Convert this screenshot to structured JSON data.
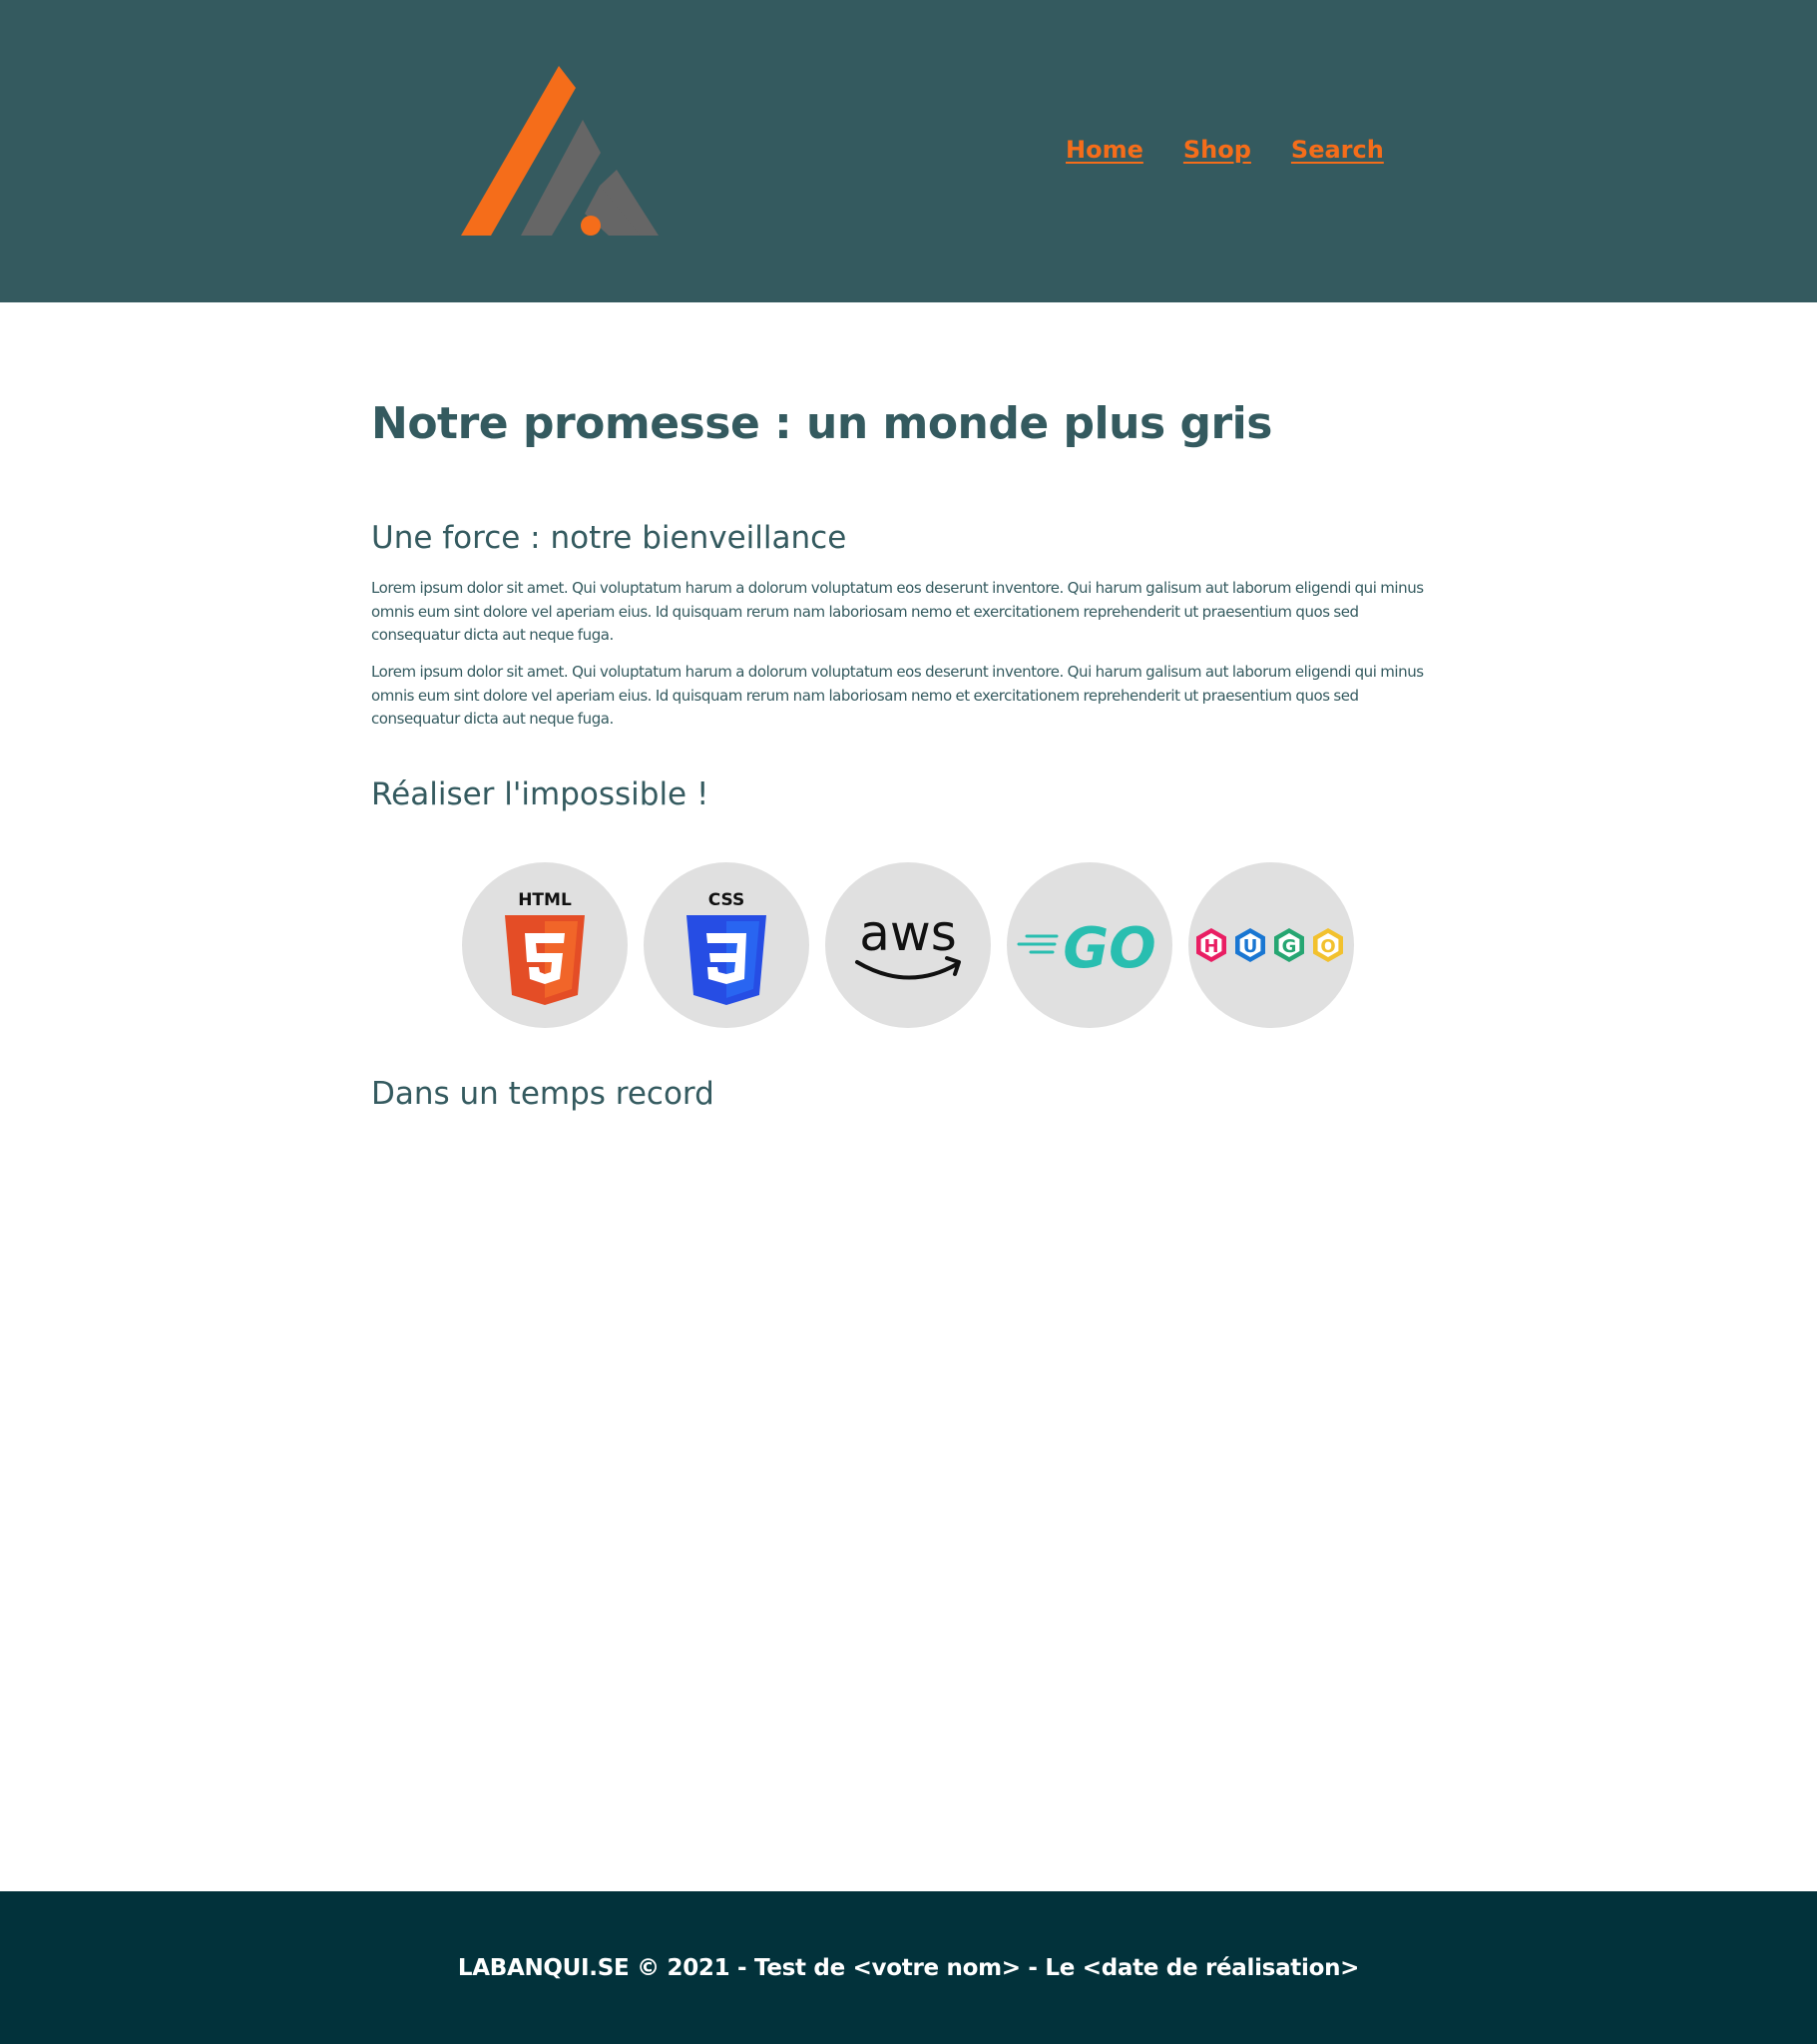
{
  "header": {
    "logo_name": "labanquise-logo",
    "nav": [
      {
        "label": "Home"
      },
      {
        "label": "Shop"
      },
      {
        "label": "Search"
      }
    ]
  },
  "main": {
    "title": "Notre promesse : un monde plus gris",
    "sections": [
      {
        "heading": "Une force : notre bienveillance",
        "paragraphs": [
          "Lorem ipsum dolor sit amet. Qui voluptatum harum a dolorum voluptatum eos deserunt inventore. Qui harum galisum aut laborum eligendi qui minus omnis eum sint dolore vel aperiam eius. Id quisquam rerum nam laboriosam nemo et exercitationem reprehenderit ut praesentium quos sed consequatur dicta aut neque fuga.",
          "Lorem ipsum dolor sit amet. Qui voluptatum harum a dolorum voluptatum eos deserunt inventore. Qui harum galisum aut laborum eligendi qui minus omnis eum sint dolore vel aperiam eius. Id quisquam rerum nam laboriosam nemo et exercitationem reprehenderit ut praesentium quos sed consequatur dicta aut neque fuga."
        ]
      },
      {
        "heading": "Réaliser l'impossible !",
        "technologies": [
          {
            "name": "html5-logo",
            "label": "HTML"
          },
          {
            "name": "css3-logo",
            "label": "CSS"
          },
          {
            "name": "aws-logo",
            "label": "aws"
          },
          {
            "name": "go-logo",
            "label": "GO"
          },
          {
            "name": "hugo-logo",
            "letters": [
              "H",
              "U",
              "G",
              "O"
            ]
          }
        ]
      },
      {
        "heading": "Dans un temps record"
      }
    ]
  },
  "footer": {
    "text": "LABANQUI.SE © 2021 - Test de <votre nom> - Le <date de réalisation>"
  },
  "colors": {
    "header_bg": "#345a5f",
    "accent": "#f56d1a",
    "text": "#345a5f",
    "footer_bg": "#02323b",
    "circle_bg": "#e0e0e0"
  }
}
